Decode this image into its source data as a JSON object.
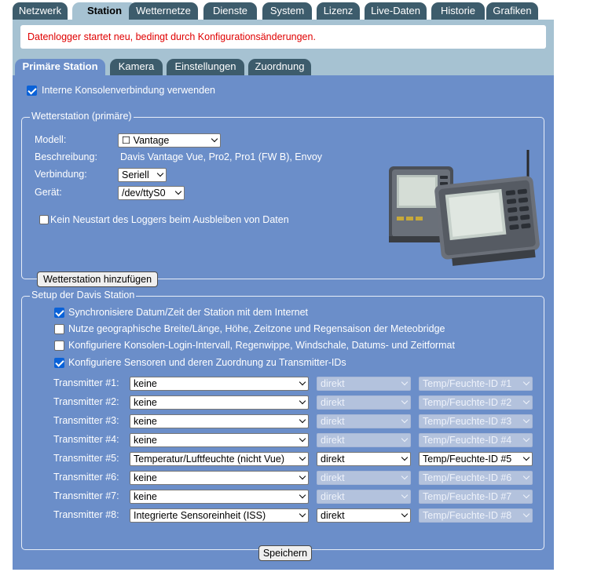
{
  "top_tabs": [
    {
      "label": "Netzwerk"
    },
    {
      "label": "Station"
    },
    {
      "label": "Wetternetze"
    },
    {
      "label": "Dienste"
    },
    {
      "label": "System"
    },
    {
      "label": "Lizenz"
    },
    {
      "label": "Live-Daten"
    },
    {
      "label": "Historie"
    },
    {
      "label": "Grafiken"
    }
  ],
  "message": "Datenlogger startet neu, bedingt durch Konfigurationsänderungen.",
  "sub_tabs": [
    {
      "label": "Primäre Station"
    },
    {
      "label": "Kamera"
    },
    {
      "label": "Einstellungen"
    },
    {
      "label": "Zuordnung"
    }
  ],
  "internal_console": {
    "label": "Interne Konsolenverbindung verwenden",
    "checked": true
  },
  "weather_station": {
    "legend": "Wetterstation (primäre)",
    "model_label": "Modell:",
    "model_value": "☐ Vantage",
    "description_label": "Beschreibung:",
    "description_value": "Davis Vantage Vue, Pro2, Pro1 (FW B), Envoy",
    "connection_label": "Verbindung:",
    "connection_value": "Seriell",
    "device_label": "Gerät:",
    "device_value": "/dev/ttyS0",
    "no_restart_label": "Kein Neustart des Loggers beim Ausbleiben von Daten",
    "no_restart_checked": false,
    "add_button": "Wetterstation hinzufügen"
  },
  "davis_setup": {
    "legend": "Setup der Davis Station",
    "options": [
      {
        "label": "Synchronisiere Datum/Zeit der Station mit dem Internet",
        "checked": true
      },
      {
        "label": "Nutze geographische Breite/Länge, Höhe, Zeitzone und Regensaison der Meteobridge",
        "checked": false
      },
      {
        "label": "Konfiguriere Konsolen-Login-Intervall, Regenwippe, Windschale, Datums- und Zeitformat",
        "checked": false
      },
      {
        "label": "Konfiguriere Sensoren und deren Zuordnung zu Transmitter-IDs",
        "checked": true
      }
    ],
    "transmitters": [
      {
        "label": "Transmitter #1:",
        "type": "keine",
        "mode": "direkt",
        "id": "Temp/Feuchte-ID #1",
        "enabled": false
      },
      {
        "label": "Transmitter #2:",
        "type": "keine",
        "mode": "direkt",
        "id": "Temp/Feuchte-ID #2",
        "enabled": false
      },
      {
        "label": "Transmitter #3:",
        "type": "keine",
        "mode": "direkt",
        "id": "Temp/Feuchte-ID #3",
        "enabled": false
      },
      {
        "label": "Transmitter #4:",
        "type": "keine",
        "mode": "direkt",
        "id": "Temp/Feuchte-ID #4",
        "enabled": false
      },
      {
        "label": "Transmitter #5:",
        "type": "Temperatur/Luftfeuchte (nicht Vue)",
        "mode": "direkt",
        "id": "Temp/Feuchte-ID #5",
        "enabled": true
      },
      {
        "label": "Transmitter #6:",
        "type": "keine",
        "mode": "direkt",
        "id": "Temp/Feuchte-ID #6",
        "enabled": false
      },
      {
        "label": "Transmitter #7:",
        "type": "keine",
        "mode": "direkt",
        "id": "Temp/Feuchte-ID #7",
        "enabled": false
      },
      {
        "label": "Transmitter #8:",
        "type": "Integrierte Sensoreinheit (ISS)",
        "mode": "direkt",
        "id": "Temp/Feuchte-ID #8",
        "enabled": "mode-only"
      }
    ]
  },
  "save_button": "Speichern",
  "colors": {
    "tab": "#3d5c6c",
    "frame": "#a6c2d2",
    "panel": "#6b8ec9",
    "message": "#e00000",
    "checkbox": "#0a62d8"
  }
}
